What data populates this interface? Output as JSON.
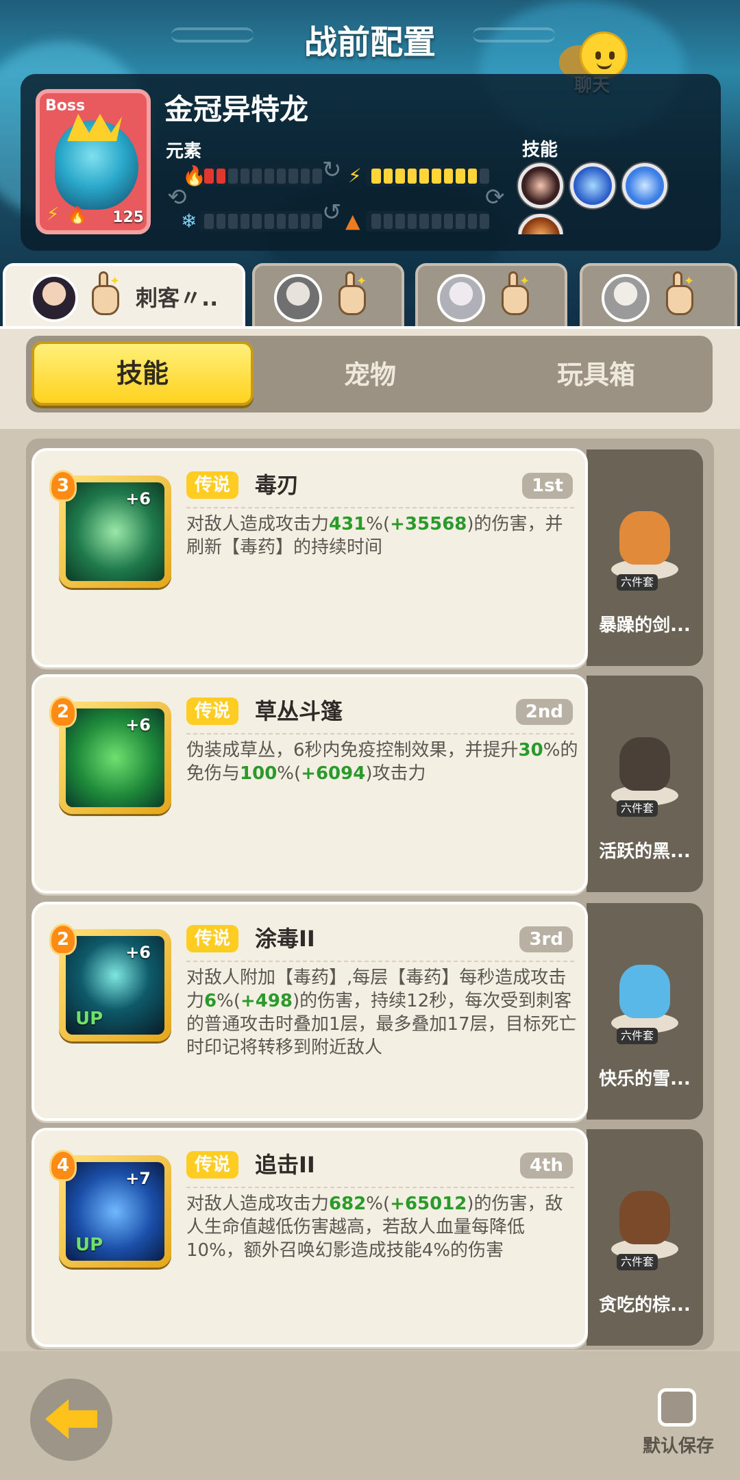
{
  "header": {
    "title": "战前配置",
    "chat_label": "聊天"
  },
  "boss": {
    "tag": "Boss",
    "level": "125",
    "name": "金冠异特龙",
    "elements_label": "元素",
    "skills_label": "技能",
    "element_bars": [
      {
        "element": "fire",
        "filled": 2,
        "total": 10,
        "color": "#e2372e"
      },
      {
        "element": "lightning",
        "filled": 9,
        "total": 10,
        "color": "#ffd53a"
      },
      {
        "element": "ice",
        "filled": 0,
        "total": 10,
        "color": "#7fd0f0"
      },
      {
        "element": "earth",
        "filled": 0,
        "total": 10,
        "color": "#f07a20"
      }
    ],
    "skill_icons": [
      "fang-skill-icon",
      "thunder-storm-icon",
      "lightning-icon",
      "earth-spike-icon"
    ]
  },
  "heroes": [
    {
      "name": "刺客〃..",
      "active": true
    },
    {
      "name": "",
      "active": false
    },
    {
      "name": "",
      "active": false
    },
    {
      "name": "",
      "active": false
    }
  ],
  "tabs": [
    {
      "label": "技能",
      "active": true
    },
    {
      "label": "宠物",
      "active": false
    },
    {
      "label": "玩具箱",
      "active": false
    }
  ],
  "skills": [
    {
      "level": "3",
      "plus": "+6",
      "rarity": "传说",
      "name": "毒刃",
      "rank": "1st",
      "up": "",
      "desc": [
        "对敌人造成攻击力",
        {
          "g": "431"
        },
        "%(",
        {
          "g": "+35568"
        },
        ")的伤害，并刷新【毒药】的持续时间"
      ],
      "pet": {
        "tag": "六件套",
        "name": "暴躁的剑..."
      }
    },
    {
      "level": "2",
      "plus": "+6",
      "rarity": "传说",
      "name": "草丛斗篷",
      "rank": "2nd",
      "up": "",
      "desc": [
        "伪装成草丛，6秒内免疫控制效果，并提升",
        {
          "g": "30"
        },
        "%的免伤与",
        {
          "g": "100"
        },
        "%(",
        {
          "g": "+6094"
        },
        ")攻击力"
      ],
      "pet": {
        "tag": "六件套",
        "name": "活跃的黑..."
      }
    },
    {
      "level": "2",
      "plus": "+6",
      "rarity": "传说",
      "name": "涂毒II",
      "rank": "3rd",
      "up": "UP",
      "desc": [
        "对敌人附加【毒药】,每层【毒药】每秒造成攻击力",
        {
          "g": "6"
        },
        "%(",
        {
          "g": "+498"
        },
        ")的伤害，持续12秒，每次受到刺客的普通攻击时叠加1层，最多叠加17层，目标死亡时印记将转移到附近敌人"
      ],
      "pet": {
        "tag": "六件套",
        "name": "快乐的雪..."
      }
    },
    {
      "level": "4",
      "plus": "+7",
      "rarity": "传说",
      "name": "追击II",
      "rank": "4th",
      "up": "UP",
      "desc": [
        "对敌人造成攻击力",
        {
          "g": "682"
        },
        "%(",
        {
          "g": "+65012"
        },
        ")的伤害，敌人生命值越低伤害越高，若敌人血量每降低10%，额外召唤幻影造成技能4%的伤害"
      ],
      "pet": {
        "tag": "六件套",
        "name": "贪吃的棕..."
      }
    }
  ],
  "footer": {
    "save_label": "默认保存"
  }
}
